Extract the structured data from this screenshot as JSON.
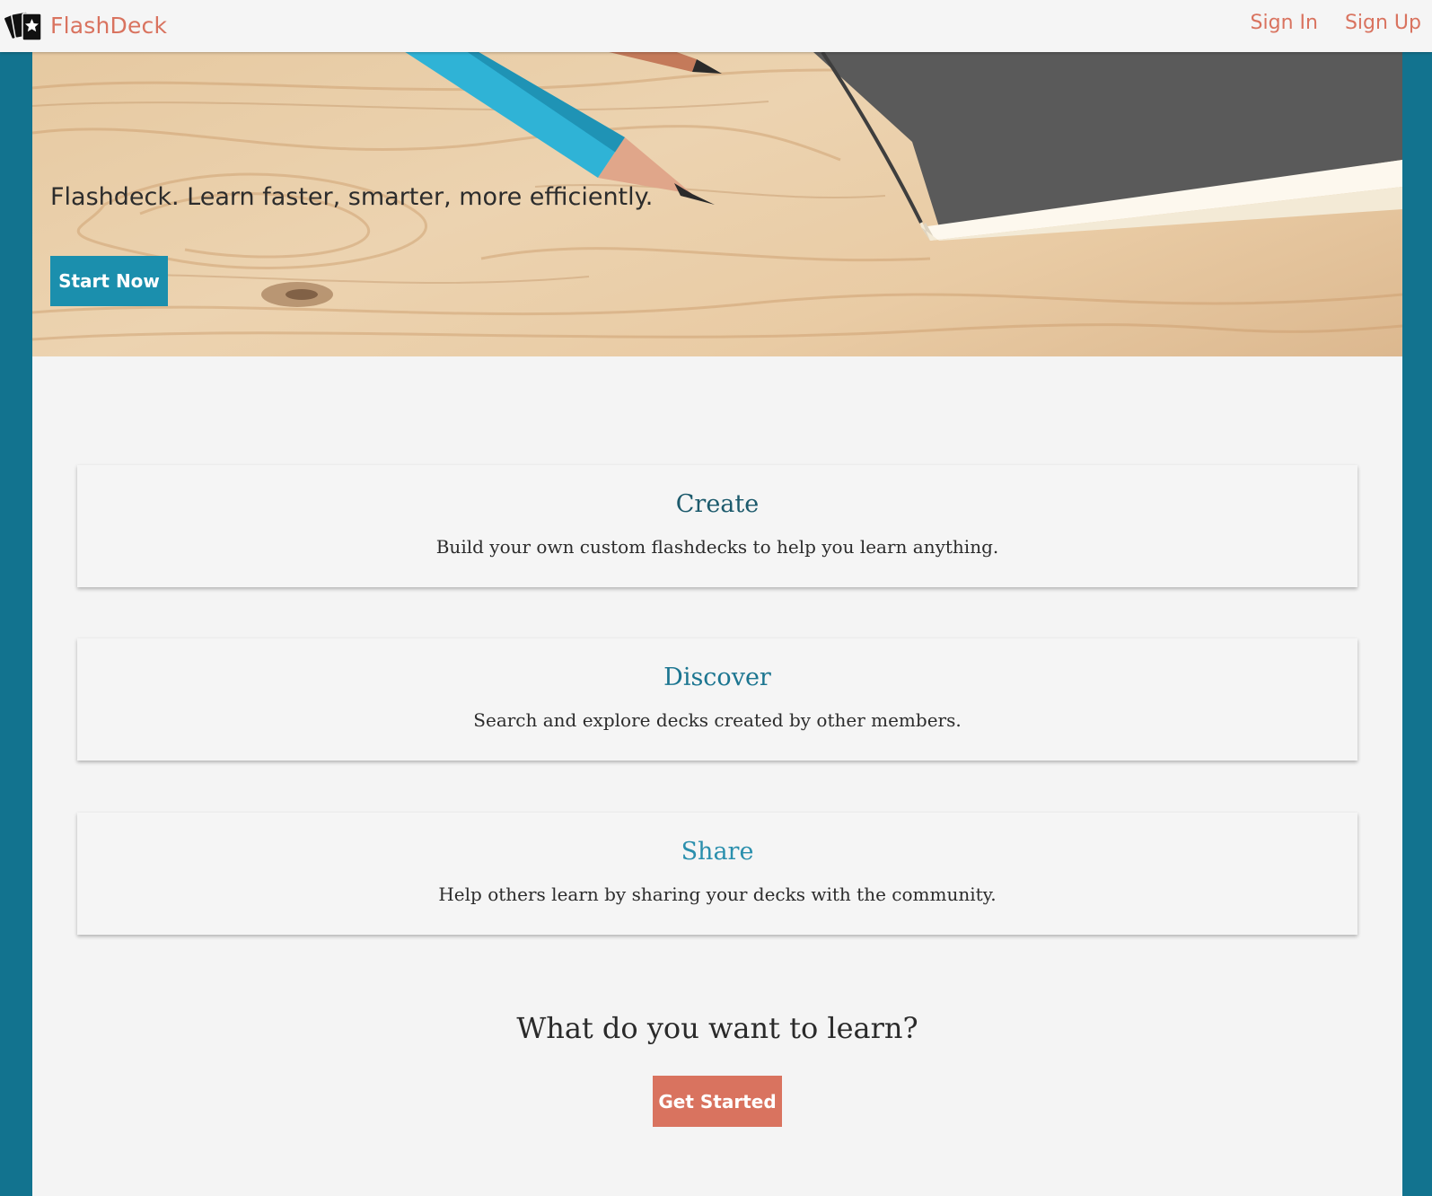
{
  "navbar": {
    "brand": "FlashDeck",
    "brand_icon": "flashcards-icon",
    "links": [
      {
        "label": "Sign In"
      },
      {
        "label": "Sign Up"
      }
    ]
  },
  "hero": {
    "tagline": "Flashdeck. Learn faster, smarter, more efficiently.",
    "button_label": "Start Now",
    "image": "pencils-and-notebook-on-wood"
  },
  "features": [
    {
      "title": "Create",
      "text": "Build your own custom flashdecks to help you learn anything.",
      "color": "#1c5a6c"
    },
    {
      "title": "Discover",
      "text": "Search and explore decks created by other members.",
      "color": "#1b7590"
    },
    {
      "title": "Share",
      "text": "Help others learn by sharing your decks with the community.",
      "color": "#2a8fad"
    }
  ],
  "cta": {
    "heading": "What do you want to learn?",
    "button_label": "Get Started"
  },
  "colors": {
    "accent": "#d9735f",
    "primary": "#1b8fad",
    "page_bg": "#12738f",
    "content_bg": "#f4f4f4"
  }
}
